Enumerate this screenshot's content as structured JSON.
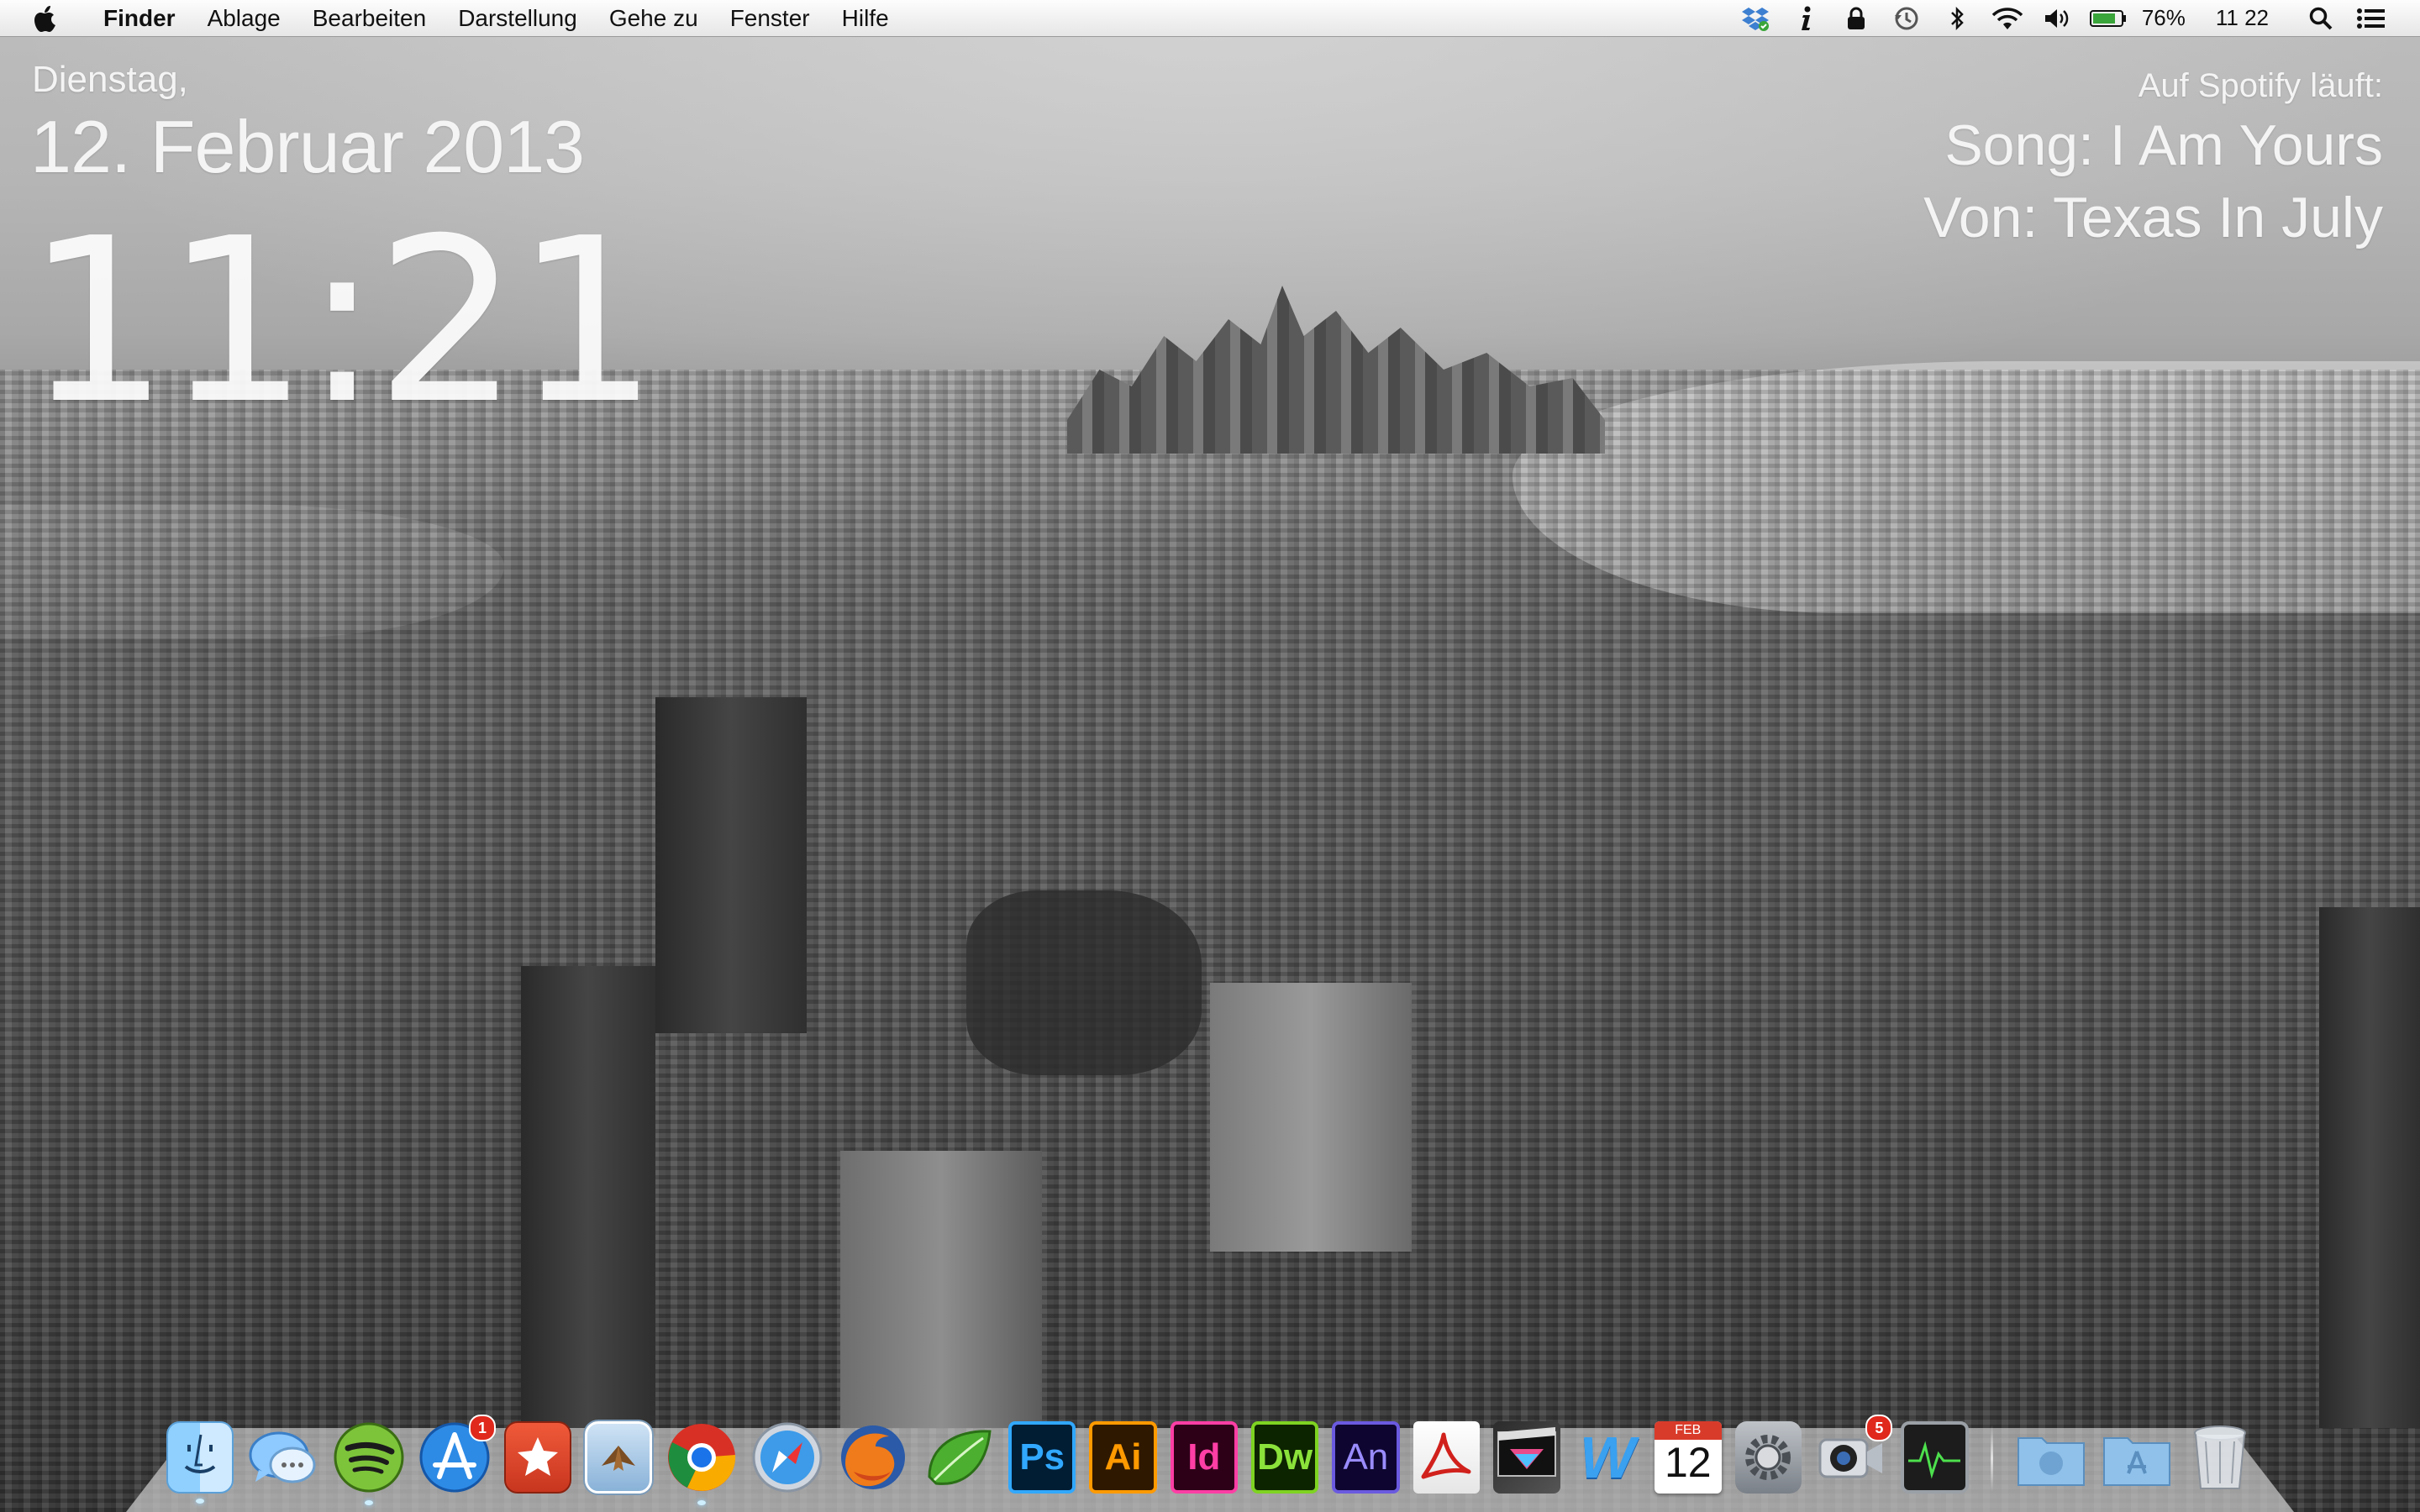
{
  "menubar": {
    "app_name": "Finder",
    "menus": [
      "Ablage",
      "Bearbeiten",
      "Darstellung",
      "Gehe zu",
      "Fenster",
      "Hilfe"
    ],
    "status": {
      "battery": "76%",
      "time": "11 22"
    }
  },
  "date_widget": {
    "weekday": "Dienstag,",
    "date": "12. Februar 2013",
    "time": "11:21"
  },
  "spotify_widget": {
    "heading": "Auf Spotify läuft:",
    "song": "Song: I Am Yours",
    "artist": "Von: Texas In July"
  },
  "dock": {
    "apps": [
      {
        "name": "finder-icon"
      },
      {
        "name": "messages-icon"
      },
      {
        "name": "spotify-icon"
      },
      {
        "name": "app-store-icon",
        "badge": "1"
      },
      {
        "name": "wunderlist-icon"
      },
      {
        "name": "mail-icon"
      },
      {
        "name": "chrome-icon"
      },
      {
        "name": "safari-icon"
      },
      {
        "name": "firefox-icon"
      },
      {
        "name": "leaf-icon"
      },
      {
        "name": "photoshop-icon",
        "label": "Ps"
      },
      {
        "name": "illustrator-icon",
        "label": "Ai"
      },
      {
        "name": "indesign-icon",
        "label": "Id"
      },
      {
        "name": "dreamweaver-icon",
        "label": "Dw"
      },
      {
        "name": "animate-icon",
        "label": "An"
      },
      {
        "name": "acrobat-icon"
      },
      {
        "name": "final-cut-icon"
      },
      {
        "name": "word-icon",
        "label": "W"
      },
      {
        "name": "calendar-icon",
        "month": "FEB",
        "day": "12"
      },
      {
        "name": "system-preferences-icon"
      },
      {
        "name": "facetime-icon",
        "badge": "5"
      },
      {
        "name": "activity-monitor-icon"
      }
    ],
    "stacks": [
      {
        "name": "downloads-stack-icon"
      },
      {
        "name": "applications-stack-icon"
      },
      {
        "name": "trash-icon"
      }
    ]
  }
}
